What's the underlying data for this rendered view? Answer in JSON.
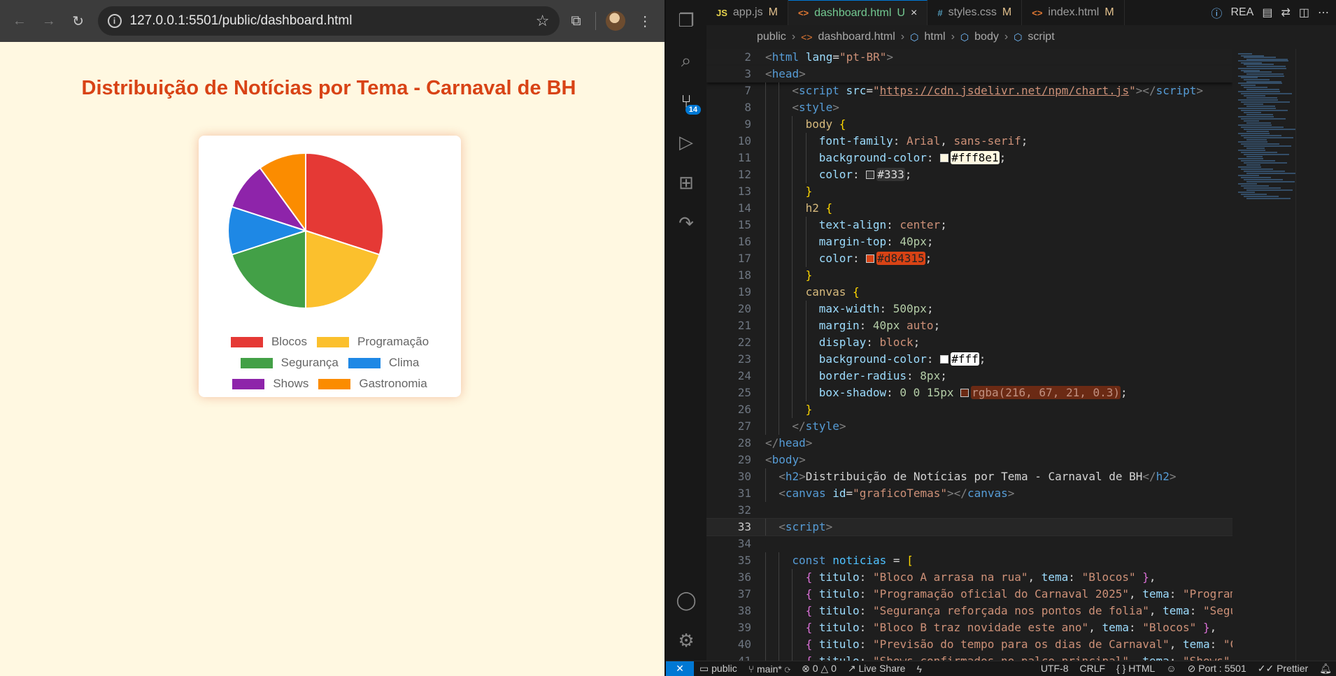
{
  "browser": {
    "url": "127.0.0.1:5501/public/dashboard.html",
    "page_title": "Distribuição de Notícias por Tema - Carnaval de BH"
  },
  "chart_data": {
    "type": "pie",
    "categories": [
      "Blocos",
      "Programação",
      "Segurança",
      "Clima",
      "Shows",
      "Gastronomia"
    ],
    "values": [
      3,
      2,
      2,
      1,
      1,
      1
    ],
    "colors": [
      "#e53935",
      "#fbc02d",
      "#43a047",
      "#1e88e5",
      "#8e24aa",
      "#fb8c00"
    ],
    "legend_position": "bottom"
  },
  "vscode": {
    "tabs": [
      {
        "icon": "JS",
        "label": "app.js",
        "mod": "M"
      },
      {
        "icon": "<>",
        "label": "dashboard.html",
        "mod": "U"
      },
      {
        "icon": "#",
        "label": "styles.css",
        "mod": "M"
      },
      {
        "icon": "<>",
        "label": "index.html",
        "mod": "M"
      }
    ],
    "tab_close": "×",
    "readme_tab": "REA",
    "badge_count": "14",
    "breadcrumbs": [
      "public",
      "dashboard.html",
      "html",
      "body",
      "script"
    ],
    "status": {
      "branch_folder": "public",
      "branch": "main*",
      "problems": "0",
      "warnings": "0",
      "live_share": "Live Share",
      "encoding": "UTF-8",
      "eol": "CRLF",
      "language": "HTML",
      "port": "Port : 5501",
      "prettier": "Prettier"
    }
  },
  "code": [
    {
      "n": "2",
      "html": "<span class='pn'>&lt;</span><span class='tg'>html</span> <span class='at'>lang</span><span class='tx'>=</span><span class='st'>\"pt-BR\"</span><span class='pn'>&gt;</span>",
      "indent": 0
    },
    {
      "n": "3",
      "html": "<span class='pn'>&lt;</span><span class='tg'>head</span><span class='pn'>&gt;</span>",
      "indent": 0
    },
    {
      "n": "7",
      "html": "<span class='pn'>&lt;</span><span class='tg'>script</span> <span class='at'>src</span><span class='tx'>=</span><span class='st'>\"<span class='ul'>https://cdn.jsdelivr.net/npm/chart.js</span>\"</span><span class='pn'>&gt;&lt;/</span><span class='tg'>script</span><span class='pn'>&gt;</span>",
      "indent": 2
    },
    {
      "n": "8",
      "html": "<span class='pn'>&lt;</span><span class='tg'>style</span><span class='pn'>&gt;</span>",
      "indent": 2
    },
    {
      "n": "9",
      "html": "<span class='sel'>body</span> <span class='br1'>{</span>",
      "indent": 3
    },
    {
      "n": "10",
      "html": "<span class='pr'>font-family</span><span class='tx'>: </span><span class='vl'>Arial</span><span class='tx'>, </span><span class='vl'>sans-serif</span><span class='tx'>;</span>",
      "indent": 4
    },
    {
      "n": "11",
      "html": "<span class='pr'>background-color</span><span class='tx'>: </span><span class='cbox' style='background:#fff8e1'></span><span class='hl' style='background:#fff8e1;color:#000'>#fff8e1</span><span class='tx'>;</span>",
      "indent": 4
    },
    {
      "n": "12",
      "html": "<span class='pr'>color</span><span class='tx'>: </span><span class='cbox' style='background:#333'></span><span class='hl' style='background:#333;color:#ddd'>#333</span><span class='tx'>;</span>",
      "indent": 4
    },
    {
      "n": "13",
      "html": "<span class='br1'>}</span>",
      "indent": 3
    },
    {
      "n": "14",
      "html": "<span class='sel'>h2</span> <span class='br1'>{</span>",
      "indent": 3
    },
    {
      "n": "15",
      "html": "<span class='pr'>text-align</span><span class='tx'>: </span><span class='vl'>center</span><span class='tx'>;</span>",
      "indent": 4
    },
    {
      "n": "16",
      "html": "<span class='pr'>margin-top</span><span class='tx'>: </span><span class='nm'>40px</span><span class='tx'>;</span>",
      "indent": 4
    },
    {
      "n": "17",
      "html": "<span class='pr'>color</span><span class='tx'>: </span><span class='cbox' style='background:#d84315'></span><span class='hl' style='background:#d84315;color:#222'>#d84315</span><span class='tx'>;</span>",
      "indent": 4
    },
    {
      "n": "18",
      "html": "<span class='br1'>}</span>",
      "indent": 3
    },
    {
      "n": "19",
      "html": "<span class='sel'>canvas</span> <span class='br1'>{</span>",
      "indent": 3
    },
    {
      "n": "20",
      "html": "<span class='pr'>max-width</span><span class='tx'>: </span><span class='nm'>500px</span><span class='tx'>;</span>",
      "indent": 4
    },
    {
      "n": "21",
      "html": "<span class='pr'>margin</span><span class='tx'>: </span><span class='nm'>40px</span> <span class='vl'>auto</span><span class='tx'>;</span>",
      "indent": 4
    },
    {
      "n": "22",
      "html": "<span class='pr'>display</span><span class='tx'>: </span><span class='vl'>block</span><span class='tx'>;</span>",
      "indent": 4
    },
    {
      "n": "23",
      "html": "<span class='pr'>background-color</span><span class='tx'>: </span><span class='cbox' style='background:#fff'></span><span class='hl' style='background:#fff;color:#000'>#fff</span><span class='tx'>;</span>",
      "indent": 4
    },
    {
      "n": "24",
      "html": "<span class='pr'>border-radius</span><span class='tx'>: </span><span class='nm'>8px</span><span class='tx'>;</span>",
      "indent": 4
    },
    {
      "n": "25",
      "html": "<span class='pr'>box-shadow</span><span class='tx'>: </span><span class='nm'>0 0 15px</span> <span class='cbox' style='background:#6b2a14'></span><span class='hl' style='background:#6b2a14;color:#c09080'>rgba(216, 67, 21, 0.3)</span><span class='tx'>;</span>",
      "indent": 4
    },
    {
      "n": "26",
      "html": "<span class='br1'>}</span>",
      "indent": 3
    },
    {
      "n": "27",
      "html": "<span class='pn'>&lt;/</span><span class='tg'>style</span><span class='pn'>&gt;</span>",
      "indent": 2
    },
    {
      "n": "28",
      "html": "<span class='pn'>&lt;/</span><span class='tg'>head</span><span class='pn'>&gt;</span>",
      "indent": 0
    },
    {
      "n": "29",
      "html": "<span class='pn'>&lt;</span><span class='tg'>body</span><span class='pn'>&gt;</span>",
      "indent": 0
    },
    {
      "n": "30",
      "html": "<span class='pn'>&lt;</span><span class='tg'>h2</span><span class='pn'>&gt;</span><span class='tx'>Distribuição de Notícias por Tema - Carnaval de BH</span><span class='pn'>&lt;/</span><span class='tg'>h2</span><span class='pn'>&gt;</span>",
      "indent": 1
    },
    {
      "n": "31",
      "html": "<span class='pn'>&lt;</span><span class='tg'>canvas</span> <span class='at'>id</span><span class='tx'>=</span><span class='st'>\"graficoTemas\"</span><span class='pn'>&gt;&lt;/</span><span class='tg'>canvas</span><span class='pn'>&gt;</span>",
      "indent": 1
    },
    {
      "n": "32",
      "html": "",
      "indent": 0
    },
    {
      "n": "33",
      "html": "<span class='pn'>&lt;</span><span class='tg'>script</span><span class='pn'>&gt;</span>",
      "indent": 1,
      "current": true
    },
    {
      "n": "34",
      "html": "",
      "indent": 0
    },
    {
      "n": "35",
      "html": "<span class='kw'>const</span> <span class='vr'>noticias</span> <span class='tx'>= </span><span class='br1'>[</span>",
      "indent": 2
    },
    {
      "n": "36",
      "html": "<span class='br2'>{</span> <span class='pr'>titulo</span><span class='tx'>: </span><span class='st'>\"Bloco A arrasa na rua\"</span><span class='tx'>, </span><span class='pr'>tema</span><span class='tx'>: </span><span class='st'>\"Blocos\"</span> <span class='br2'>}</span><span class='tx'>,</span>",
      "indent": 3
    },
    {
      "n": "37",
      "html": "<span class='br2'>{</span> <span class='pr'>titulo</span><span class='tx'>: </span><span class='st'>\"Programação oficial do Carnaval 2025\"</span><span class='tx'>, </span><span class='pr'>tema</span><span class='tx'>: </span><span class='st'>\"Programação</span>",
      "indent": 3
    },
    {
      "n": "38",
      "html": "<span class='br2'>{</span> <span class='pr'>titulo</span><span class='tx'>: </span><span class='st'>\"Segurança reforçada nos pontos de folia\"</span><span class='tx'>, </span><span class='pr'>tema</span><span class='tx'>: </span><span class='st'>\"Seguranç</span>",
      "indent": 3
    },
    {
      "n": "39",
      "html": "<span class='br2'>{</span> <span class='pr'>titulo</span><span class='tx'>: </span><span class='st'>\"Bloco B traz novidade este ano\"</span><span class='tx'>, </span><span class='pr'>tema</span><span class='tx'>: </span><span class='st'>\"Blocos\"</span> <span class='br2'>}</span><span class='tx'>,</span>",
      "indent": 3
    },
    {
      "n": "40",
      "html": "<span class='br2'>{</span> <span class='pr'>titulo</span><span class='tx'>: </span><span class='st'>\"Previsão do tempo para os dias de Carnaval\"</span><span class='tx'>, </span><span class='pr'>tema</span><span class='tx'>: </span><span class='st'>\"Clima</span>",
      "indent": 3
    },
    {
      "n": "41",
      "html": "<span class='br2'>{</span> <span class='pr'>titulo</span><span class='tx'>: </span><span class='st'>\"Shows confirmados no palco principal\"</span><span class='tx'>, </span><span class='pr'>tema</span><span class='tx'>: </span><span class='st'>\"Shows\"</span> <span class='br2'>}</span><span class='tx'>,</span>",
      "indent": 3
    }
  ]
}
